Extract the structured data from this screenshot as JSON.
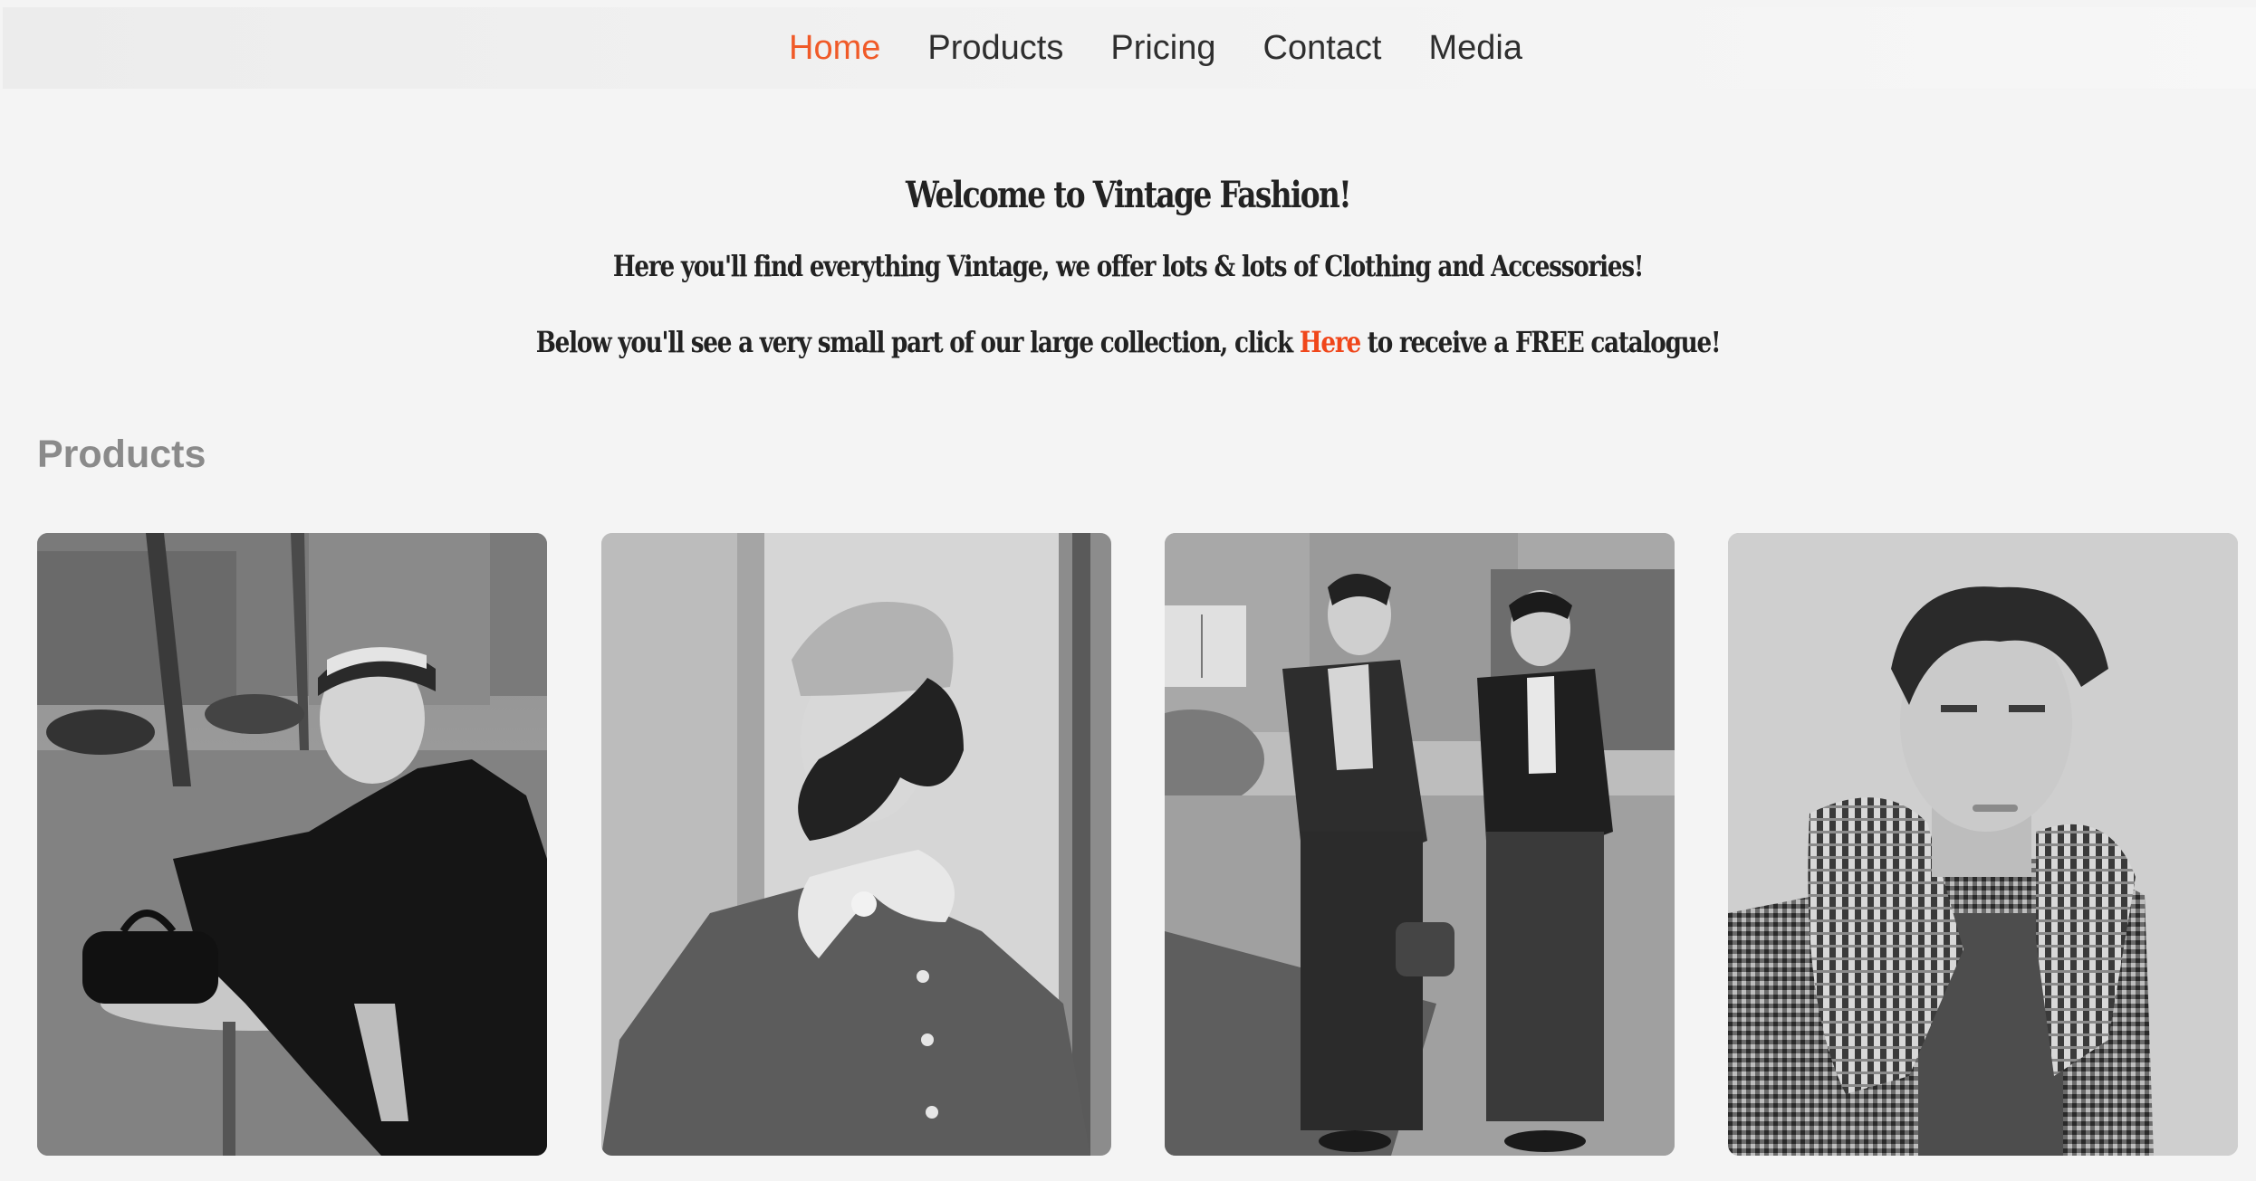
{
  "nav": {
    "items": [
      {
        "label": "Home",
        "active": true
      },
      {
        "label": "Products",
        "active": false
      },
      {
        "label": "Pricing",
        "active": false
      },
      {
        "label": "Contact",
        "active": false
      },
      {
        "label": "Media",
        "active": false
      }
    ],
    "active_color": "#f05a28"
  },
  "hero": {
    "title": "Welcome to Vintage Fashion!",
    "line1": "Here you'll find everything Vintage, we offer lots & lots of Clothing and Accessories!",
    "line2_before": "Below you'll see a very small part of our large collection, click ",
    "line2_link": "Here",
    "line2_after": " to receive a FREE catalogue!",
    "link_color": "#f0461a"
  },
  "products": {
    "heading": "Products",
    "items": [
      {
        "image": "woman-cafe-table-photo"
      },
      {
        "image": "woman-beret-fur-collar-photo"
      },
      {
        "image": "two-young-men-street-photo"
      },
      {
        "image": "young-man-checked-scarf-photo"
      }
    ]
  }
}
